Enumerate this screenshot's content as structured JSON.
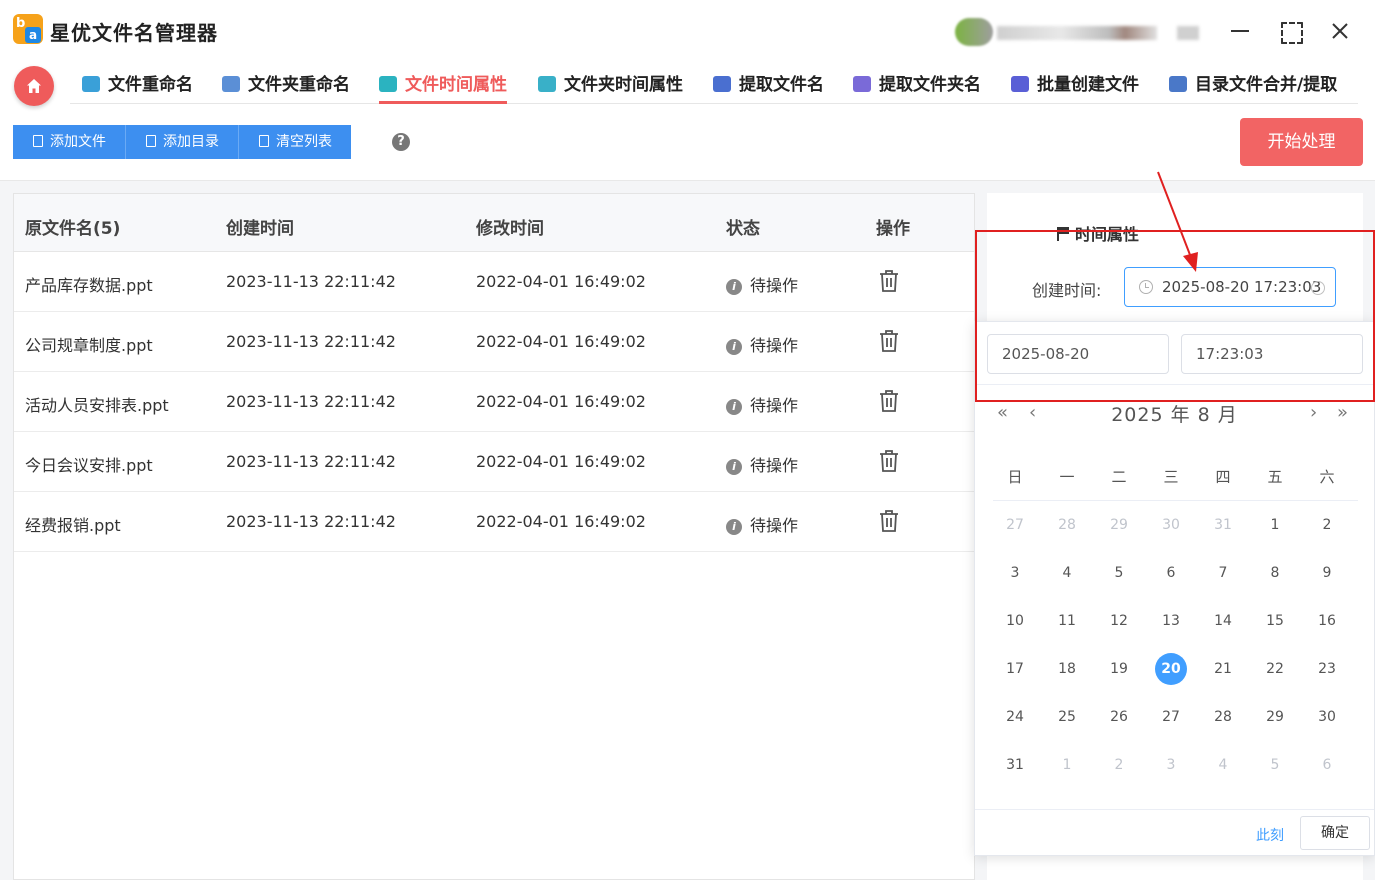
{
  "app": {
    "title": "星优文件名管理器"
  },
  "tabs": [
    {
      "label": "文件重命名",
      "color": "#3aa0d8"
    },
    {
      "label": "文件夹重命名",
      "color": "#5b8fd6"
    },
    {
      "label": "文件时间属性",
      "color": "#2bb3c0",
      "active": true
    },
    {
      "label": "文件夹时间属性",
      "color": "#39b0c8"
    },
    {
      "label": "提取文件名",
      "color": "#4a6fd0"
    },
    {
      "label": "提取文件夹名",
      "color": "#7a6ad8"
    },
    {
      "label": "批量创建文件",
      "color": "#5a5fd6"
    },
    {
      "label": "目录文件合并/提取",
      "color": "#4a78c8"
    }
  ],
  "toolbar": {
    "add_file": "添加文件",
    "add_dir": "添加目录",
    "clear_list": "清空列表",
    "help": "?",
    "start": "开始处理"
  },
  "table": {
    "headers": {
      "name": "原文件名(5)",
      "created": "创建时间",
      "modified": "修改时间",
      "status": "状态",
      "action": "操作"
    },
    "rows": [
      {
        "name": "产品库存数据.ppt",
        "created": "2023-11-13 22:11:42",
        "modified": "2022-04-01 16:49:02",
        "status": "待操作"
      },
      {
        "name": "公司规章制度.ppt",
        "created": "2023-11-13 22:11:42",
        "modified": "2022-04-01 16:49:02",
        "status": "待操作"
      },
      {
        "name": "活动人员安排表.ppt",
        "created": "2023-11-13 22:11:42",
        "modified": "2022-04-01 16:49:02",
        "status": "待操作"
      },
      {
        "name": "今日会议安排.ppt",
        "created": "2023-11-13 22:11:42",
        "modified": "2022-04-01 16:49:02",
        "status": "待操作"
      },
      {
        "name": "经费报销.ppt",
        "created": "2023-11-13 22:11:42",
        "modified": "2022-04-01 16:49:02",
        "status": "待操作"
      }
    ]
  },
  "panel": {
    "title": "时间属性",
    "created_label": "创建时间:",
    "created_value": "2025-08-20 17:23:03"
  },
  "picker": {
    "date_value": "2025-08-20",
    "time_value": "17:23:03",
    "month_label": "2025 年  8 月",
    "weekdays": [
      "日",
      "一",
      "二",
      "三",
      "四",
      "五",
      "六"
    ],
    "weeks": [
      [
        "27",
        "28",
        "29",
        "30",
        "31",
        "1",
        "2"
      ],
      [
        "3",
        "4",
        "5",
        "6",
        "7",
        "8",
        "9"
      ],
      [
        "10",
        "11",
        "12",
        "13",
        "14",
        "15",
        "16"
      ],
      [
        "17",
        "18",
        "19",
        "20",
        "21",
        "22",
        "23"
      ],
      [
        "24",
        "25",
        "26",
        "27",
        "28",
        "29",
        "30"
      ],
      [
        "31",
        "1",
        "2",
        "3",
        "4",
        "5",
        "6"
      ]
    ],
    "selected_day": "20",
    "now_label": "此刻",
    "ok_label": "确定"
  },
  "colors": {
    "accent": "#ef5b5b",
    "primary": "#3d8ff0",
    "picker_selected": "#409eff",
    "annotation": "#e02020"
  }
}
